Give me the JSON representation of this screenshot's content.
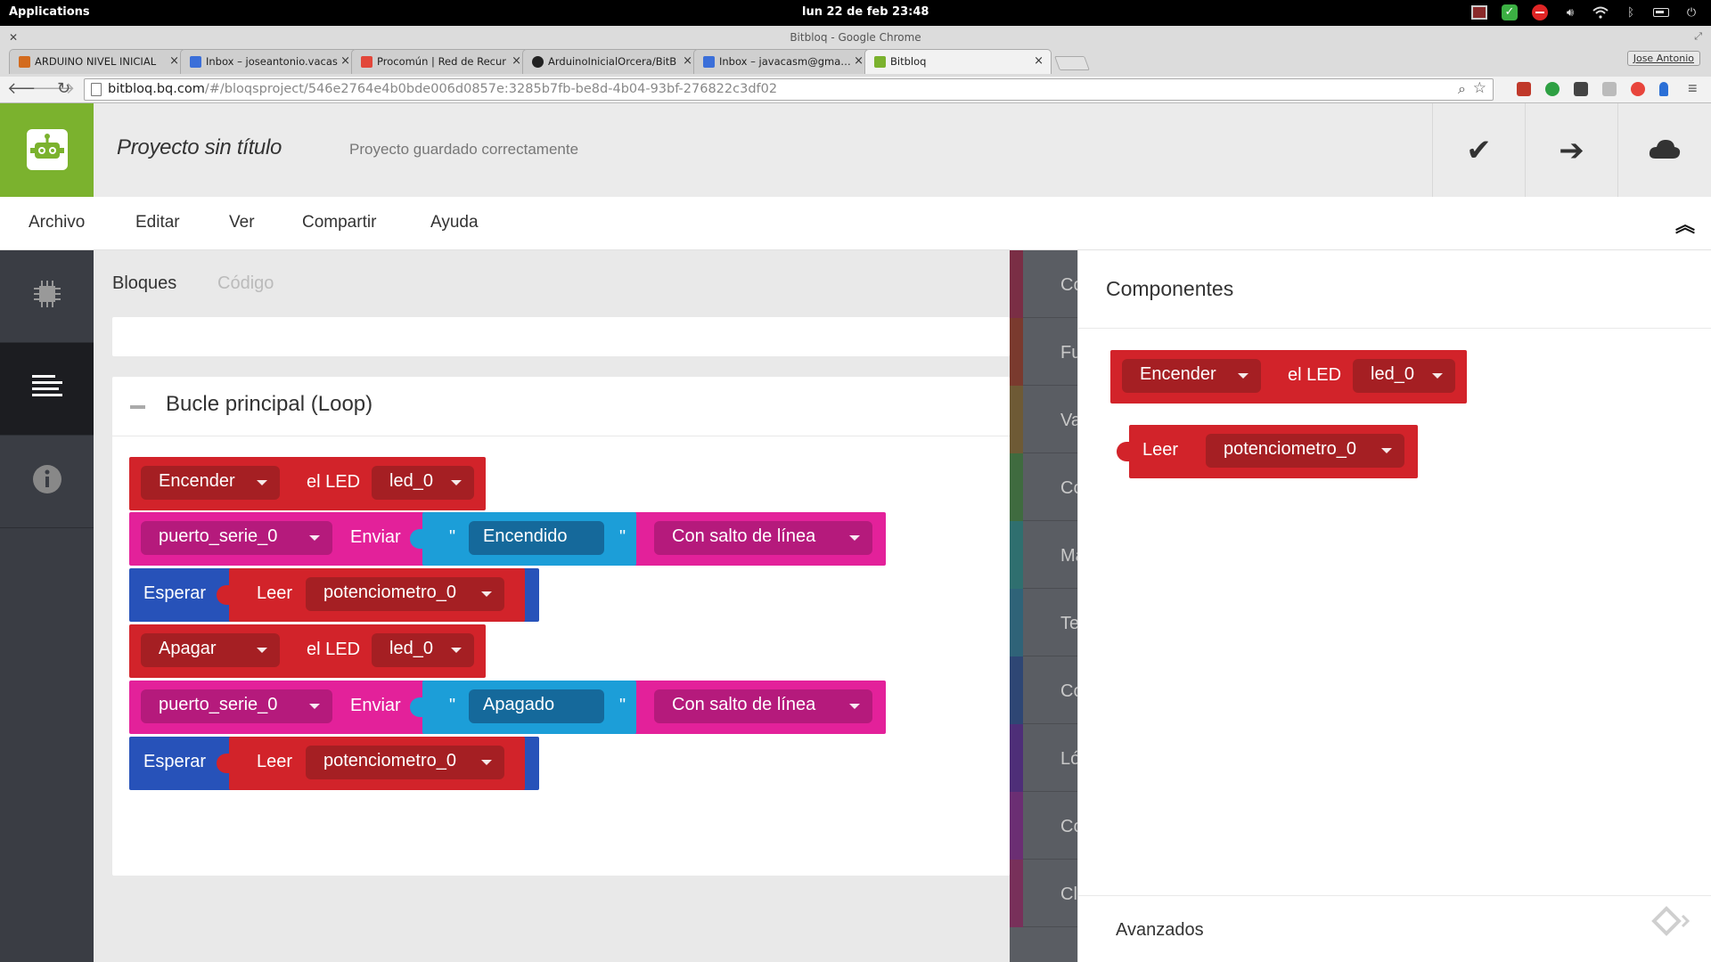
{
  "os": {
    "apps_label": "Applications",
    "clock": "lun 22 de feb   23:48"
  },
  "window": {
    "title": "Bitbloq - Google Chrome",
    "user": "Jose Antonio",
    "tabs": [
      {
        "label": "ARDUINO NIVEL INICIAL",
        "favicon_color": "#d36b1e"
      },
      {
        "label": "Inbox – joseantonio.vacas",
        "favicon_color": "#3b6fd9"
      },
      {
        "label": "Procomún | Red de Recur",
        "favicon_color": "#e2473a"
      },
      {
        "label": "ArduinoInicialOrcera/BitB",
        "favicon_color": "#222222"
      },
      {
        "label": "Inbox – javacasm@gmail.c",
        "favicon_color": "#3b6fd9"
      },
      {
        "label": "Bitbloq",
        "favicon_color": "#7bb22e"
      }
    ]
  },
  "address_bar": {
    "host": "bitbloq.bq.com",
    "path": "/#/bloqsproject/546e2764e4b0bde006d0857e:3285b7fb-be8d-4b04-93bf-276822c3df02"
  },
  "header": {
    "project_title": "Proyecto sin título",
    "save_status": "Proyecto guardado correctamente"
  },
  "menu": {
    "items": [
      "Archivo",
      "Editar",
      "Ver",
      "Compartir",
      "Ayuda"
    ]
  },
  "workspace": {
    "tab_blocks": "Bloques",
    "tab_code": "Código",
    "loop_title": "Bucle principal (Loop)",
    "blocks": {
      "b1_action": "Encender",
      "b1_label": "el LED",
      "b1_target": "led_0",
      "b2_port": "puerto_serie_0",
      "b2_label": "Enviar",
      "b2_quote_open": "\"",
      "b2_text": "Encendido",
      "b2_quote_close": "\"",
      "b2_mode": "Con salto de línea",
      "b3_label": "Esperar",
      "b3_read": "Leer",
      "b3_sensor": "potenciometro_0",
      "b4_action": "Apagar",
      "b4_label": "el LED",
      "b4_target": "led_0",
      "b5_port": "puerto_serie_0",
      "b5_label": "Enviar",
      "b5_quote_open": "\"",
      "b5_text": "Apagado",
      "b5_quote_close": "\"",
      "b5_mode": "Con salto de línea",
      "b6_label": "Esperar",
      "b6_read": "Leer",
      "b6_sensor": "potenciometro_0"
    }
  },
  "toolbox": {
    "categories": [
      {
        "label": "Con",
        "color": "#7a2e45"
      },
      {
        "label": "Fun",
        "color": "#7a3a2e"
      },
      {
        "label": "Var",
        "color": "#6e5a35"
      },
      {
        "label": "Cód",
        "color": "#3f6b3f"
      },
      {
        "label": "Mat",
        "color": "#2f6f6f"
      },
      {
        "label": "Tex",
        "color": "#2f6378"
      },
      {
        "label": "Cor",
        "color": "#2e4674"
      },
      {
        "label": "Lóg",
        "color": "#4e2e78"
      },
      {
        "label": "Cor",
        "color": "#6b2e73"
      },
      {
        "label": "Clas",
        "color": "#78305a"
      }
    ]
  },
  "components": {
    "title": "Componentes",
    "block1_action": "Encender",
    "block1_label": "el LED",
    "block1_target": "led_0",
    "block2_read": "Leer",
    "block2_sensor": "potenciometro_0",
    "advanced_label": "Avanzados"
  },
  "colors": {
    "brand_green": "#7bb22e",
    "component_red": "#d2232a",
    "serial_pink": "#e3219a",
    "wait_blue": "#2752b9",
    "text_cyan": "#1c9ed8"
  }
}
